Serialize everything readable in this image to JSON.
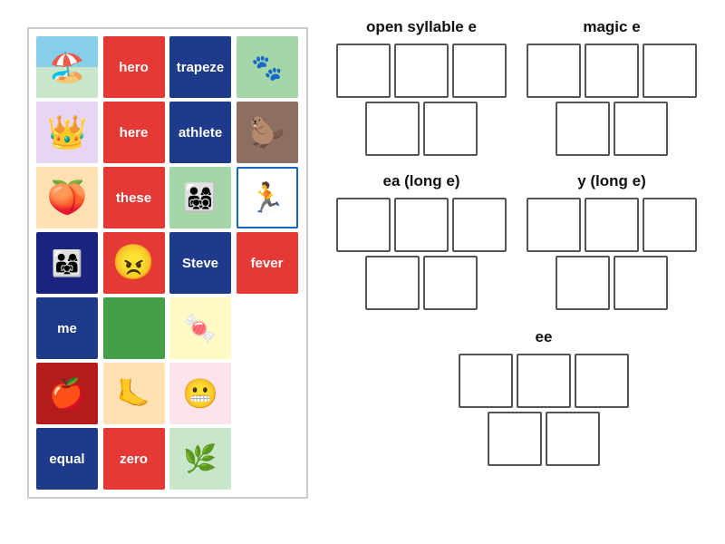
{
  "leftPanel": {
    "cards": [
      {
        "type": "image",
        "imgClass": "img-beach",
        "emoji": "🏖️",
        "label": "beach"
      },
      {
        "type": "text",
        "bg": "red",
        "text": "hero"
      },
      {
        "type": "text",
        "bg": "blue",
        "text": "trapeze"
      },
      {
        "type": "image",
        "imgClass": "img-animal",
        "emoji": "🐾",
        "label": "animal"
      },
      {
        "type": "image",
        "imgClass": "img-queen",
        "emoji": "👑",
        "label": "queen"
      },
      {
        "type": "text",
        "bg": "red",
        "text": "here"
      },
      {
        "type": "text",
        "bg": "blue",
        "text": "athlete"
      },
      {
        "type": "image",
        "imgClass": "img-beaver",
        "emoji": "🦫",
        "label": "beaver"
      },
      {
        "type": "image",
        "imgClass": "img-peach",
        "emoji": "🍑",
        "label": "peach"
      },
      {
        "type": "text",
        "bg": "red",
        "text": "these"
      },
      {
        "type": "image",
        "imgClass": "img-kids",
        "emoji": "👨‍👩‍👧‍👦",
        "label": "family-kids"
      },
      {
        "type": "image",
        "imgClass": "img-runner",
        "emoji": "🏃",
        "label": "runner"
      },
      {
        "type": "image",
        "imgClass": "img-family",
        "emoji": "👨‍👩‍👧",
        "label": "family"
      },
      {
        "type": "text",
        "bg": "red",
        "text": "😠",
        "isEmoji": true
      },
      {
        "type": "text",
        "bg": "blue",
        "text": "Steve"
      },
      {
        "type": "text",
        "bg": "red",
        "text": "fever"
      },
      {
        "type": "text",
        "bg": "blue",
        "text": "me"
      },
      {
        "type": "text",
        "bg": "light-green",
        "text": ""
      },
      {
        "type": "image",
        "imgClass": "img-candy",
        "emoji": "🍬",
        "label": "candy"
      },
      {
        "type": "empty"
      },
      {
        "type": "image",
        "imgClass": "img-pomegranate",
        "emoji": "🍎",
        "label": "pomegranate"
      },
      {
        "type": "image",
        "imgClass": "img-feet",
        "emoji": "🦶",
        "label": "feet"
      },
      {
        "type": "image",
        "imgClass": "img-mouth",
        "emoji": "😬",
        "label": "mouth"
      },
      {
        "type": "empty"
      },
      {
        "type": "text",
        "bg": "blue",
        "text": "equal"
      },
      {
        "type": "text",
        "bg": "red",
        "text": "zero"
      },
      {
        "type": "image",
        "imgClass": "img-greenbeans",
        "emoji": "🌿",
        "label": "greenbeans"
      },
      {
        "type": "empty"
      }
    ]
  },
  "rightPanel": {
    "categories": [
      {
        "id": "open-syllable-e",
        "title": "open syllable e",
        "rows": [
          {
            "boxes": 3
          },
          {
            "boxes": 2
          }
        ]
      },
      {
        "id": "magic-e",
        "title": "magic e",
        "rows": [
          {
            "boxes": 3
          },
          {
            "boxes": 2
          }
        ]
      },
      {
        "id": "ea-long-e",
        "title": "ea (long e)",
        "rows": [
          {
            "boxes": 3
          },
          {
            "boxes": 2
          }
        ]
      },
      {
        "id": "y-long-e",
        "title": "y (long e)",
        "rows": [
          {
            "boxes": 3
          },
          {
            "boxes": 2
          }
        ]
      },
      {
        "id": "ee",
        "title": "ee",
        "rows": [
          {
            "boxes": 3
          },
          {
            "boxes": 2
          }
        ]
      }
    ]
  }
}
